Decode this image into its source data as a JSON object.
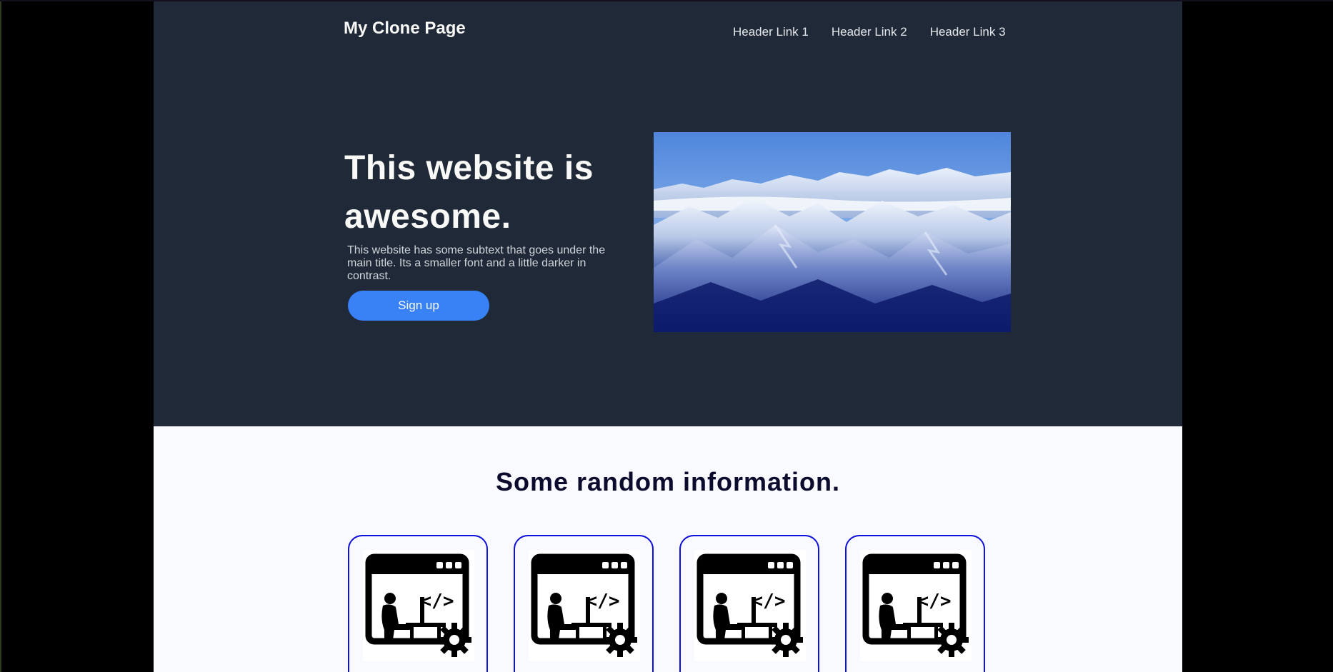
{
  "header": {
    "logo": "My Clone Page",
    "links": [
      "Header Link 1",
      "Header Link 2",
      "Header Link 3"
    ]
  },
  "hero": {
    "title": "This website is awesome.",
    "subtext": "This website has some subtext that goes under the main title. Its a smaller font and a little darker in contrast.",
    "button_label": "Sign up",
    "image": "snowy-mountains-photo"
  },
  "info": {
    "title": "Some random information.",
    "cards": [
      {
        "icon": "developer-workstation-icon"
      },
      {
        "icon": "developer-workstation-icon"
      },
      {
        "icon": "developer-workstation-icon"
      },
      {
        "icon": "developer-workstation-icon"
      }
    ]
  },
  "colors": {
    "hero_bg": "#1f2937",
    "accent": "#3882f6",
    "card_border": "#1010e0",
    "page_bg": "#f9faff"
  }
}
